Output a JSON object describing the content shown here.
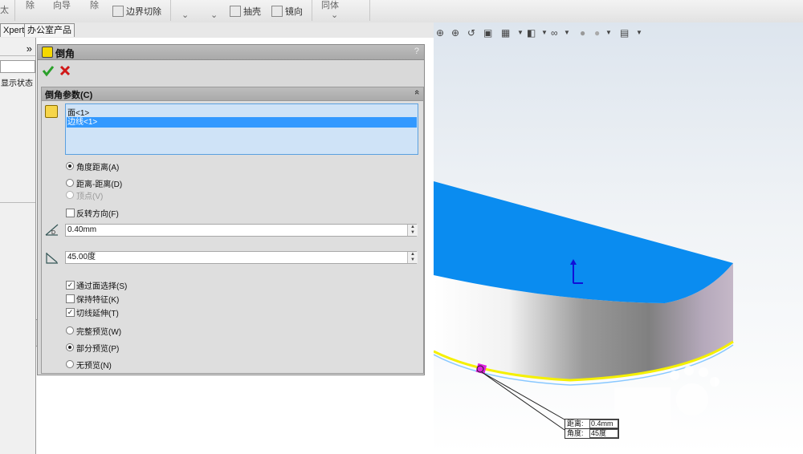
{
  "ribbon": {
    "items": [
      "除",
      "向导",
      "除",
      "抽壳",
      "镜向",
      "同体"
    ],
    "boundary_cut": "边界切除"
  },
  "tabs": [
    "Xpert",
    "办公室产品"
  ],
  "left_panel": {
    "expand_symbol": "»",
    "display_state": "显示状态"
  },
  "feature": {
    "title": "倒角",
    "help": "?",
    "ok_icon": "check-icon",
    "cancel_icon": "close-icon",
    "section_title": "倒角参数(C)",
    "collapse_symbol": "«",
    "selections": [
      "面<1>",
      "边线<1>"
    ],
    "selected_index": 1,
    "modes": [
      {
        "label": "角度距离(A)",
        "checked": true,
        "disabled": false
      },
      {
        "label": "距离-距离(D)",
        "checked": false,
        "disabled": false
      },
      {
        "label": "顶点(V)",
        "checked": false,
        "disabled": true
      }
    ],
    "flip_direction": {
      "label": "反转方向(F)",
      "checked": false
    },
    "distance_value": "0.40mm",
    "angle_value": "45.00度",
    "options": [
      {
        "label": "通过面选择(S)",
        "checked": true
      },
      {
        "label": "保持特征(K)",
        "checked": false
      },
      {
        "label": "切线延伸(T)",
        "checked": true
      }
    ],
    "preview": [
      {
        "label": "完整预览(W)",
        "checked": false
      },
      {
        "label": "部分预览(P)",
        "checked": true
      },
      {
        "label": "无预览(N)",
        "checked": false
      }
    ]
  },
  "callout": {
    "distance_label": "距离:",
    "distance_value": "0.4mm",
    "angle_label": "角度:",
    "angle_value": "45度"
  },
  "colors": {
    "top_face": "#0a8cf0",
    "edge_highlight": "#f5f000",
    "selection": "#3399ff",
    "marker": "#e020e0"
  }
}
